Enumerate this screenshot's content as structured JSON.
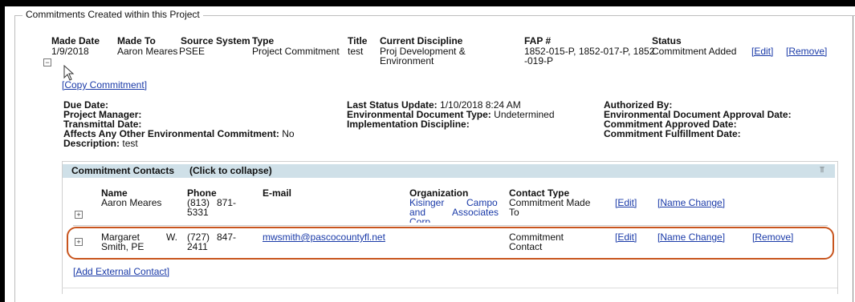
{
  "section": {
    "legend": "Commitments Created within this Project"
  },
  "commitment": {
    "headers": {
      "made_date": "Made Date",
      "made_to": "Made To",
      "source_system": "Source System",
      "type": "Type",
      "title": "Title",
      "current_discipline": "Current Discipline",
      "fap": "FAP #",
      "status": "Status"
    },
    "values": {
      "made_date": "1/9/2018",
      "made_to": "Aaron Meares",
      "source_system": "PSEE",
      "type": "Project Commitment",
      "title": "test",
      "current_discipline_1": "Proj Development &",
      "current_discipline_2": "Environment",
      "fap_1": "1852-015-P, 1852-017-P, 1852",
      "fap_2": "-019-P",
      "status": "Commitment Added"
    },
    "edit_label": "[Edit]",
    "remove_label": "[Remove]",
    "copy_label": "[Copy Commitment]",
    "collapse_icon": "minus-box-icon"
  },
  "details": {
    "col1": {
      "due_date": "Due Date:",
      "project_manager": "Project Manager:",
      "transmittal_date": "Transmittal Date:",
      "affects_label": "Affects Any Other Environmental Commitment:",
      "affects_value": "No",
      "description_label": "Description:",
      "description_value": "test"
    },
    "col2": {
      "last_status_label": "Last Status Update:",
      "last_status_value": "1/10/2018 8:24 AM",
      "env_doc_type_label": "Environmental Document Type:",
      "env_doc_type_value": "Undetermined",
      "impl_discipline_label": "Implementation Discipline:"
    },
    "col3": {
      "authorized_by": "Authorized By:",
      "env_doc_approval": "Environmental Document Approval Date:",
      "commitment_approved": "Commitment Approved Date:",
      "commitment_fulfillment": "Commitment Fulfillment Date:"
    }
  },
  "contacts": {
    "title": "Commitment Contacts",
    "collapse_hint": "(Click to collapse)",
    "collapse_glyph": "⫪",
    "headers": {
      "name": "Name",
      "phone": "Phone",
      "email": "E-mail",
      "organization": "Organization",
      "contact_type": "Contact Type"
    },
    "rows": [
      {
        "name_1": "Aaron Meares",
        "name_2": "",
        "phone_1": "(813)",
        "phone_1b": "871-",
        "phone_2": "5331",
        "email": "",
        "org_1a": "Kisinger",
        "org_1b": "Campo",
        "org_2a": "and",
        "org_2b": "Associates",
        "org_3": "Corp",
        "type_1": "Commitment Made",
        "type_2": "To",
        "edit_label": "[Edit]",
        "name_change_label": "[Name Change]",
        "remove_label": ""
      },
      {
        "name_1a": "Margaret",
        "name_1b": "W.",
        "name_2": "Smith, PE",
        "phone_1": "(727)",
        "phone_1b": "847-",
        "phone_2": "2411",
        "email": "mwsmith@pascocountyfl.net",
        "type_1": "Commitment",
        "type_2": "Contact",
        "edit_label": "[Edit]",
        "name_change_label": "[Name Change]",
        "remove_label": "[Remove]"
      }
    ],
    "add_external_label": "[Add External Contact]",
    "expand_icon": "plus-box-icon"
  },
  "colors": {
    "link": "#1a3aa8",
    "header_band": "#cfe0e8",
    "highlight": "#c8551e"
  }
}
